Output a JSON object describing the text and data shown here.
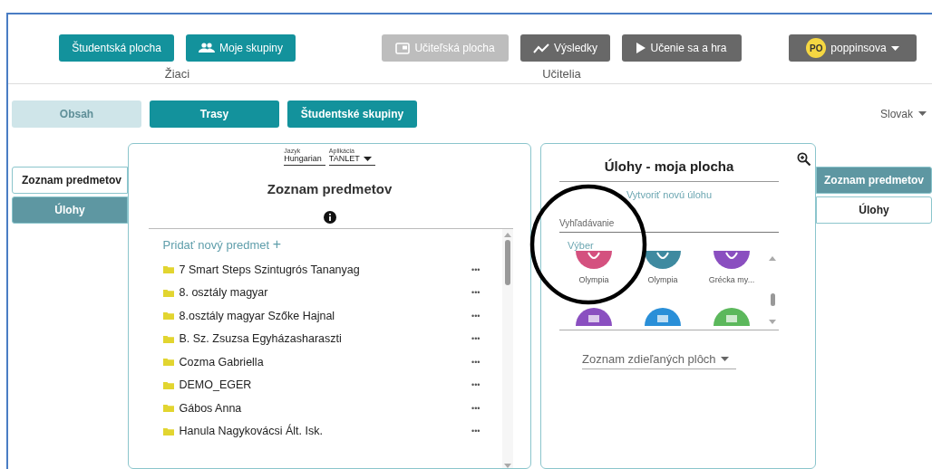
{
  "header": {
    "student_group": {
      "label": "Žiaci",
      "buttons": [
        {
          "label": "Študentská plocha",
          "disabled": false
        },
        {
          "label": "Moje skupiny",
          "disabled": false
        }
      ]
    },
    "teacher_group": {
      "label": "Učitelia",
      "buttons": [
        {
          "label": "Učiteľská plocha",
          "disabled": true
        },
        {
          "label": "Výsledky",
          "disabled": false
        },
        {
          "label": "Učenie sa a hra",
          "disabled": false
        }
      ]
    },
    "user": {
      "initials": "PO",
      "name": "poppinsova"
    }
  },
  "subnav": {
    "buttons": [
      {
        "label": "Obsah",
        "disabled": true
      },
      {
        "label": "Trasy",
        "disabled": false
      },
      {
        "label": "Študentské skupiny",
        "disabled": false
      }
    ],
    "language": "Slovak"
  },
  "left_tabs": [
    {
      "label": "Zoznam predmetov",
      "selected": true
    },
    {
      "label": "Úlohy",
      "selected": false
    }
  ],
  "subjects_panel": {
    "language_label": "Jazyk",
    "language": "Hungarian",
    "app_label": "Aplikácia",
    "app": "TANLET",
    "title": "Zoznam predmetov",
    "add_link": "Pridať nový predmet",
    "add_icon": "+",
    "items": [
      {
        "name": "7 Smart Steps Szintugrós Tananyag",
        "menu": "•••"
      },
      {
        "name": "8. osztály magyar",
        "menu": "•••"
      },
      {
        "name": "8.osztály magyar Szőke Hajnal",
        "menu": "•••"
      },
      {
        "name": "B. Sz. Zsuzsa Egyházasharaszti",
        "menu": "•••"
      },
      {
        "name": "Cozma Gabriella",
        "menu": "•••"
      },
      {
        "name": "DEMO_EGER",
        "menu": "•••"
      },
      {
        "name": "Gábos Anna",
        "menu": "•••"
      },
      {
        "name": "Hanula Nagykovácsi Ált. Isk.",
        "menu": "•••"
      }
    ]
  },
  "tasks_panel": {
    "title": "Úlohy - moja plocha",
    "create_link": "Vytvoriť novú úlohu",
    "search": {
      "placeholder": "Vyhľadávanie"
    },
    "selection_label": "Výber",
    "tiles": [
      {
        "label": "Olympia",
        "color": "#d4517f"
      },
      {
        "label": "Olympia",
        "color": "#3f8aa0"
      },
      {
        "label": "Grécka my...",
        "color": "#8a4fc0"
      },
      {
        "color": "#8a4fc0"
      },
      {
        "color": "#2a8fd8"
      },
      {
        "color": "#5cb85c"
      }
    ],
    "shared_dropdown": "Zoznam zdieľaných plôch"
  },
  "right_tabs": [
    {
      "label": "Zoznam predmetov",
      "selected": false
    },
    {
      "label": "Úlohy",
      "selected": true
    }
  ]
}
